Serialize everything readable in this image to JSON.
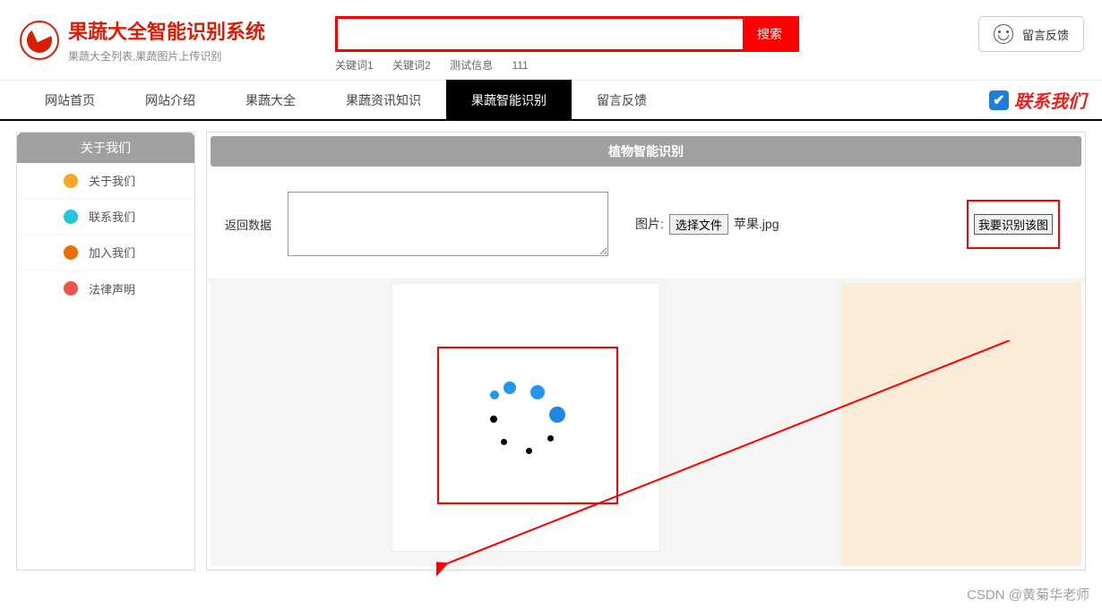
{
  "header": {
    "title": "果蔬大全智能识别系统",
    "subtitle": "果蔬大全列表,果蔬图片上传识别"
  },
  "search": {
    "button": "搜索",
    "placeholder": "",
    "keywords": [
      "关键词1",
      "关键词2",
      "测试信息",
      "111"
    ]
  },
  "feedback_top": "留言反馈",
  "nav": {
    "items": [
      "网站首页",
      "网站介绍",
      "果蔬大全",
      "果蔬资讯知识",
      "果蔬智能识别",
      "留言反馈"
    ],
    "active_index": 4
  },
  "contact_us": "联系我们",
  "sidebar": {
    "title": "关于我们",
    "items": [
      "关于我们",
      "联系我们",
      "加入我们",
      "法律声明"
    ]
  },
  "main": {
    "title": "植物智能识别",
    "return_label": "返回数据",
    "image_label": "图片:",
    "file_button": "选择文件",
    "file_name": "苹果.jpg",
    "recognize_button": "我要识别该图"
  },
  "watermark": "CSDN @黄菊华老师"
}
